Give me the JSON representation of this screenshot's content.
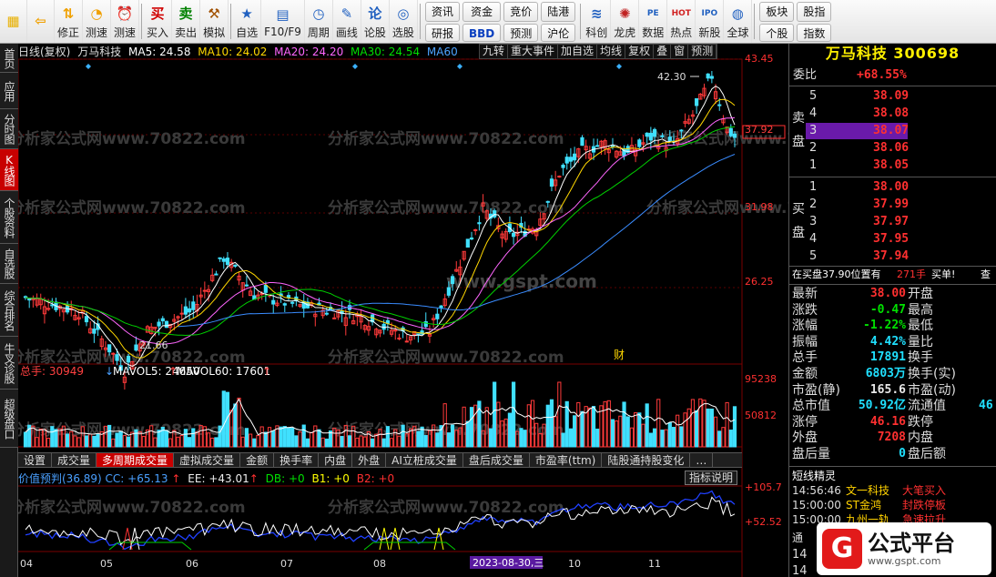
{
  "toolbar": {
    "buttons": [
      {
        "label": "",
        "icon": "grid-icon"
      },
      {
        "label": "",
        "icon": "back-arrow-icon"
      },
      {
        "label": "修正",
        "icon": "up-down-icon"
      },
      {
        "label": "测速",
        "icon": "clock-icon"
      },
      {
        "label": "测速",
        "icon": "alarm-icon"
      },
      {
        "label": "买入",
        "icon": "buy-icon",
        "mark": "买"
      },
      {
        "label": "卖出",
        "icon": "sell-icon",
        "mark": "卖"
      },
      {
        "label": "模拟",
        "icon": "hammer-icon"
      },
      {
        "label": "自选",
        "icon": "star-icon"
      },
      {
        "label": "F10/F9",
        "icon": "f10-icon"
      },
      {
        "label": "周期",
        "icon": "period-icon"
      },
      {
        "label": "画线",
        "icon": "pencil-icon"
      },
      {
        "label": "论股",
        "icon": "discuss-icon",
        "mark": "论"
      },
      {
        "label": "选股",
        "icon": "select-icon"
      }
    ],
    "group1": [
      "资讯",
      "资金",
      "竞价",
      "陆港",
      "研报",
      "BBD",
      "预测",
      "沪伦"
    ],
    "buttons2": [
      {
        "label": "科创",
        "icon": "chart-icon"
      },
      {
        "label": "龙虎",
        "icon": "dragon-icon"
      },
      {
        "label": "数据",
        "icon": "pe-icon",
        "mark": "PE"
      },
      {
        "label": "热点",
        "icon": "hot-icon",
        "mark": "HOT"
      },
      {
        "label": "新股",
        "icon": "ipo-icon",
        "mark": "IPO"
      },
      {
        "label": "全球",
        "icon": "globe-icon"
      }
    ],
    "group2": [
      "板块",
      "股指",
      "个股",
      "指数"
    ]
  },
  "left_tabs": [
    {
      "label": "首页",
      "active": false
    },
    {
      "label": "应用",
      "active": false
    },
    {
      "label": "分时图",
      "active": false
    },
    {
      "label": "K线图",
      "active": true
    },
    {
      "label": "个股资料",
      "active": false
    },
    {
      "label": "自选股",
      "active": false
    },
    {
      "label": "综合排名",
      "active": false
    },
    {
      "label": "牛叉诊股",
      "active": false
    },
    {
      "label": "超级盘口",
      "active": false
    }
  ],
  "chart_header": {
    "mode": "日线(复权)",
    "name": "万马科技",
    "ma5": "MA5: 24.58",
    "ma10": "MA10: 24.02",
    "ma20": "MA20: 24.20",
    "ma30": "MA30: 24.54",
    "ma60": "MA60",
    "menu": [
      "九转",
      "重大事件",
      "加自选",
      "均线",
      "复权",
      "叠",
      "窗",
      "预测"
    ]
  },
  "price_axis": [
    "43.45",
    "37.92",
    "31.98",
    "26.25"
  ],
  "price_labels": {
    "high": "42.30",
    "low": "21.66",
    "fin": "财"
  },
  "volume_header": {
    "total": "总手: 30949",
    "mavol5": "MAVOL5: 24650",
    "mavol60": "MAVOL60: 17601"
  },
  "volume_axis": [
    "95238",
    "50812"
  ],
  "sub_tabs": [
    {
      "label": "设置",
      "active": false
    },
    {
      "label": "成交量",
      "active": false
    },
    {
      "label": "多周期成交量",
      "active": true
    },
    {
      "label": "虚拟成交量",
      "active": false
    },
    {
      "label": "金额",
      "active": false
    },
    {
      "label": "换手率",
      "active": false
    },
    {
      "label": "内盘",
      "active": false
    },
    {
      "label": "外盘",
      "active": false
    },
    {
      "label": "AI立桩成交量",
      "active": false
    },
    {
      "label": "盘后成交量",
      "active": false
    },
    {
      "label": "市盈率(ttm)",
      "active": false
    },
    {
      "label": "陆股通持股变化",
      "active": false
    },
    {
      "label": "…",
      "active": false
    }
  ],
  "indicator_header": {
    "name": "价值预判(36.89)",
    "cc": "CC: +65.13",
    "ee": "EE: +43.01",
    "db": "DB: +0",
    "b1": "B1: +0",
    "b2": "B2: +0",
    "explain": "指标说明"
  },
  "indicator_axis": [
    "+105.7",
    "+52.52"
  ],
  "date_axis": [
    "04",
    "05",
    "06",
    "07",
    "08",
    "10",
    "11"
  ],
  "date_cursor": "2023-08-30,三",
  "watermarks": [
    "分析家公式网www.70822.com",
    "www.gspt.com"
  ],
  "right": {
    "title": "万马科技 300698",
    "weibi_label": "委比",
    "weibi": "+68.55%",
    "sell_label": "卖盘",
    "buy_label": "买盘",
    "sell": [
      {
        "lvl": "5",
        "price": "38.09"
      },
      {
        "lvl": "4",
        "price": "38.08"
      },
      {
        "lvl": "3",
        "price": "38.07"
      },
      {
        "lvl": "2",
        "price": "38.06"
      },
      {
        "lvl": "1",
        "price": "38.05"
      }
    ],
    "buy": [
      {
        "lvl": "1",
        "price": "38.00"
      },
      {
        "lvl": "2",
        "price": "37.99"
      },
      {
        "lvl": "3",
        "price": "37.97"
      },
      {
        "lvl": "4",
        "price": "37.95"
      },
      {
        "lvl": "5",
        "price": "37.94"
      }
    ],
    "notice": "在买盘37.90位置有",
    "notice_vol": "271手",
    "notice_tail": "买单!",
    "notice_more": "查",
    "stats": [
      {
        "l": "最新",
        "v": "38.00",
        "c": "red",
        "r": "开盘",
        "rv": ""
      },
      {
        "l": "涨跌",
        "v": "-0.47",
        "c": "green",
        "r": "最高",
        "rv": ""
      },
      {
        "l": "涨幅",
        "v": "-1.22%",
        "c": "green",
        "r": "最低",
        "rv": ""
      },
      {
        "l": "振幅",
        "v": "4.42%",
        "c": "cyan",
        "r": "量比",
        "rv": ""
      },
      {
        "l": "总手",
        "v": "17891",
        "c": "cyan",
        "r": "换手",
        "rv": ""
      },
      {
        "l": "金额",
        "v": "6803万",
        "c": "cyan",
        "r": "换手(实)",
        "rv": ""
      },
      {
        "l": "市盈(静)",
        "v": "165.6",
        "c": "white",
        "r": "市盈(动)",
        "rv": ""
      },
      {
        "l": "总市值",
        "v": "50.92亿",
        "c": "cyan",
        "r": "流通值",
        "rv": "46"
      },
      {
        "l": "涨停",
        "v": "46.16",
        "c": "red",
        "r": "跌停",
        "rv": ""
      },
      {
        "l": "外盘",
        "v": "7208",
        "c": "red",
        "r": "内盘",
        "rv": ""
      },
      {
        "l": "盘后量",
        "v": "0",
        "c": "cyan",
        "r": "盘后额",
        "rv": ""
      }
    ],
    "sprite_title": "短线精灵",
    "sprites": [
      {
        "time": "14:56:46",
        "name": "文一科技",
        "event": "大笔买入"
      },
      {
        "time": "15:00:00",
        "name": "ST金鸿",
        "event": "封跌停板"
      },
      {
        "time": "15:00:00",
        "name": "九州一轨",
        "event": "急速拉升"
      }
    ],
    "tong_label": "通",
    "bottom_rows": [
      "14",
      "14"
    ]
  },
  "logo": {
    "text": "公式平台",
    "url": "www.gspt.com"
  }
}
